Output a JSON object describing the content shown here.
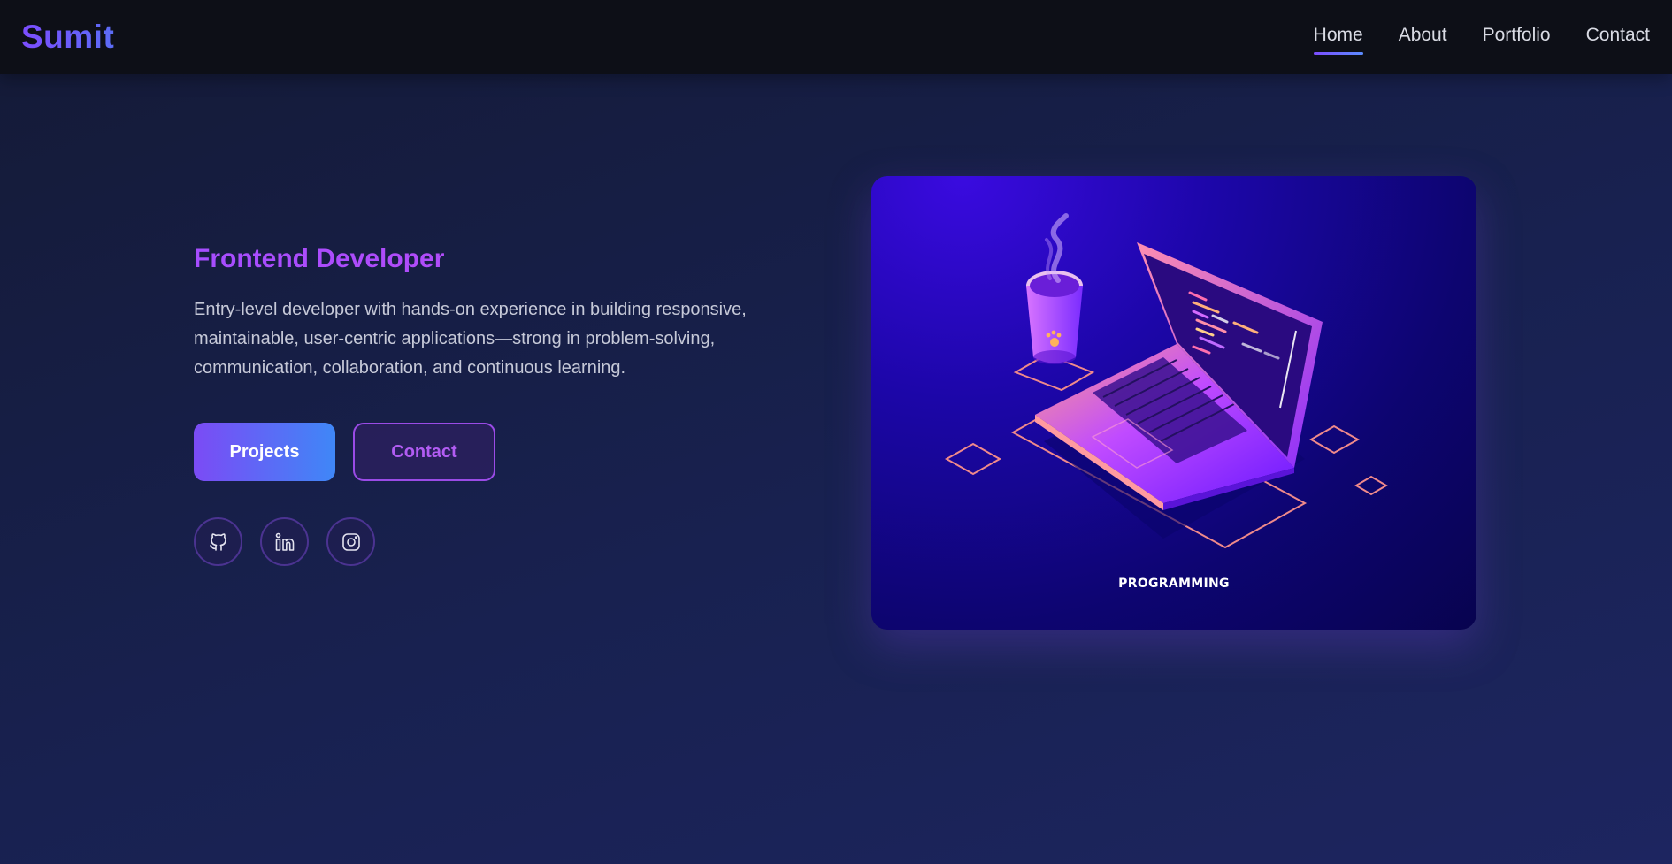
{
  "brand": {
    "name": "Sumit"
  },
  "nav": {
    "items": [
      {
        "label": "Home",
        "active": true
      },
      {
        "label": "About",
        "active": false
      },
      {
        "label": "Portfolio",
        "active": false
      },
      {
        "label": "Contact",
        "active": false
      }
    ]
  },
  "hero": {
    "role": "Frontend Developer",
    "description": "Entry-level developer with hands-on experience in building responsive, maintainable, user-centric applications—strong in problem-solving, communication, collaboration, and continuous learning.",
    "buttons": {
      "projects_label": "Projects",
      "contact_label": "Contact"
    },
    "socials": [
      {
        "icon": "github-icon"
      },
      {
        "icon": "linkedin-icon"
      },
      {
        "icon": "instagram-icon"
      }
    ],
    "illustration": {
      "caption": "PROGRAMMING"
    }
  },
  "colors": {
    "accent": "#7c4dff",
    "accent_blue": "#3f87f7",
    "role_purple": "#b04cf2",
    "navbar_bg": "#0d0f17",
    "page_bg": "#161c40"
  }
}
